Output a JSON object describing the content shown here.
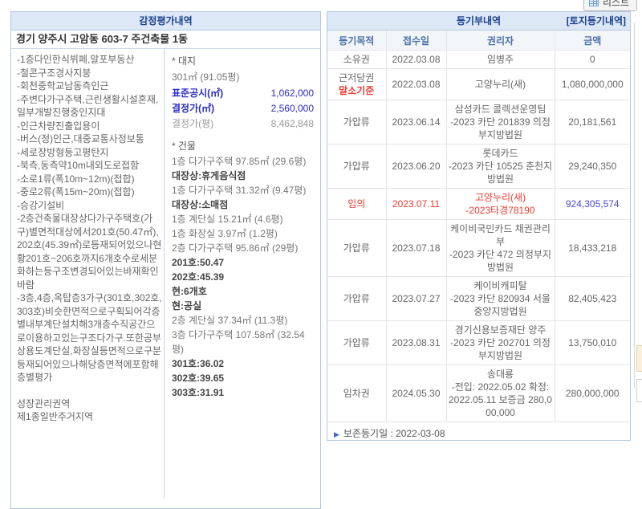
{
  "page": {
    "list_button_label": "리스트"
  },
  "icons": {
    "arrow_marker": "▶"
  },
  "colors": {
    "panel_header_bg": "#dce8f6",
    "panel_title_text": "#1a3e8f",
    "column_header_text": "#4a71a8",
    "red_highlight": "#f23a30",
    "blue_value": "#2b2bc8",
    "blue_amount": "#4949d8"
  },
  "appraisal": {
    "title": "감정평가내역",
    "address": "경기 양주시 고암동 603-7 주건축물 1동",
    "notes": [
      "-1층다인한식뷔페,알포부동산",
      "-철콘구조경사지붕",
      "-회천중학교남동측인근",
      "-주변다가구주택,근린생활시설혼재,일부개발진행중인지대",
      "-인근차량진출입용이",
      "-버스(정)인근,대중교통사정보통",
      "-세로장방형등고평탄지",
      "-북측,동측약10m내외도로접함",
      "-소로1류(폭10m~12m)(접합)",
      "-중로2류(폭15m~20m)(접합)",
      "-승강기설비",
      "-2층건축물대장상다가구주택호(가구)별면적대상에서201호(50.47㎡),202호(45.39㎡)로등재되어있으나현황201호~206호까지6개호수로세분화하는등구조변경되어있는바재확인바람",
      "-3층,4층,옥탑층3가구(301호,302호,303호)비슷한면적으로구획되어각층별내부계단설치해3개층수직공간으로이용하고있는구조다가구.또한공부상용도계단실,화장실등면적으로구분등재되어있으나해당층면적에포함해층별평가"
    ],
    "zoning": [
      "성장관리권역",
      "제1종일반주거지역"
    ],
    "land": {
      "section_label": "* 대지",
      "area_line": "301㎡ (91.05평)",
      "rows": [
        {
          "label": "표준공시(㎡)",
          "value": "1,062,000",
          "style": "blue"
        },
        {
          "label": "결정가(㎡)",
          "value": "2,560,000",
          "style": "blue"
        },
        {
          "label": "결정가(평)",
          "value": "8,462,848",
          "style": "gray"
        }
      ]
    },
    "building": {
      "section_label": "* 건물",
      "lines": [
        {
          "text": "1층 다가구주택 97.85㎡ (29.6평)",
          "bold": false
        },
        {
          "text": "대장상:휴게음식점",
          "bold": true
        },
        {
          "text": "1층 다가구주택 31.32㎡ (9.47평)",
          "bold": false
        },
        {
          "text": "대장상:소매점",
          "bold": true
        },
        {
          "text": "1층 계단실 15.21㎡ (4.6평)",
          "bold": false
        },
        {
          "text": "1층 화장실 3.97㎡ (1.2평)",
          "bold": false
        },
        {
          "text": "2층 다가구주택 95.86㎡ (29평)",
          "bold": false
        },
        {
          "text": "201호:50.47",
          "bold": true
        },
        {
          "text": "202호:45.39",
          "bold": true
        },
        {
          "text": "현:6개호",
          "bold": true
        },
        {
          "text": "현:공실",
          "bold": true
        },
        {
          "text": "2층 계단실 37.34㎡ (11.3평)",
          "bold": false
        },
        {
          "text": "3층 다가구주택 107.58㎡ (32.54평)",
          "bold": false
        },
        {
          "text": "301호:36.02",
          "bold": true
        },
        {
          "text": "302호:39.65",
          "bold": true
        },
        {
          "text": "303호:31.91",
          "bold": true
        }
      ]
    }
  },
  "registry": {
    "title": "등기부내역",
    "subtitle": "[토지등기내역]",
    "columns": [
      "등기목적",
      "접수일",
      "권리자",
      "금액"
    ],
    "rows": [
      {
        "purpose": "소유권",
        "purpose_sub": "",
        "date": "2022.03.08",
        "holder": "임병주",
        "amount": "0",
        "row_style": "normal",
        "amount_style": "normal"
      },
      {
        "purpose": "근저당권",
        "purpose_sub": "말소기준",
        "date": "2022.03.08",
        "holder": "고양누리(새)",
        "amount": "1,080,000,000",
        "row_style": "normal",
        "amount_style": "normal"
      },
      {
        "purpose": "가압류",
        "purpose_sub": "",
        "date": "2023.06.14",
        "holder": "삼성카드 콜렉션운영팀\n-2023 카단 201839 의정부지방법원",
        "amount": "20,181,561",
        "row_style": "normal",
        "amount_style": "normal"
      },
      {
        "purpose": "가압류",
        "purpose_sub": "",
        "date": "2023.06.20",
        "holder": "롯데카드\n-2023 카단 10525 춘천지방법원",
        "amount": "29,240,350",
        "row_style": "normal",
        "amount_style": "normal"
      },
      {
        "purpose": "임의",
        "purpose_sub": "",
        "date": "2023.07.11",
        "holder": "고양누리(새)\n-2023타경78190",
        "amount": "924,305,574",
        "row_style": "red",
        "amount_style": "blue"
      },
      {
        "purpose": "가압류",
        "purpose_sub": "",
        "date": "2023.07.18",
        "holder": "케이비국민카드 채권관리부\n-2023 카단 472 의정부지방법원",
        "amount": "18,433,218",
        "row_style": "normal",
        "amount_style": "normal"
      },
      {
        "purpose": "가압류",
        "purpose_sub": "",
        "date": "2023.07.27",
        "holder": "케이비캐피탈\n-2023 카단 820934 서울중앙지방법원",
        "amount": "82,405,423",
        "row_style": "normal",
        "amount_style": "normal"
      },
      {
        "purpose": "가압류",
        "purpose_sub": "",
        "date": "2023.08.31",
        "holder": "경기신용보증재단 양주\n-2023 카단 202701 의정부지방법원",
        "amount": "13,750,010",
        "row_style": "normal",
        "amount_style": "normal"
      },
      {
        "purpose": "임차권",
        "purpose_sub": "",
        "date": "2024.05.30",
        "holder": "송대룡\n-전입: 2022.05.02 확정: 2022.05.11 보증금 280,000,000",
        "amount": "280,000,000",
        "row_style": "normal",
        "amount_style": "normal"
      }
    ],
    "footer": "보존등기일 : 2022-03-08"
  }
}
